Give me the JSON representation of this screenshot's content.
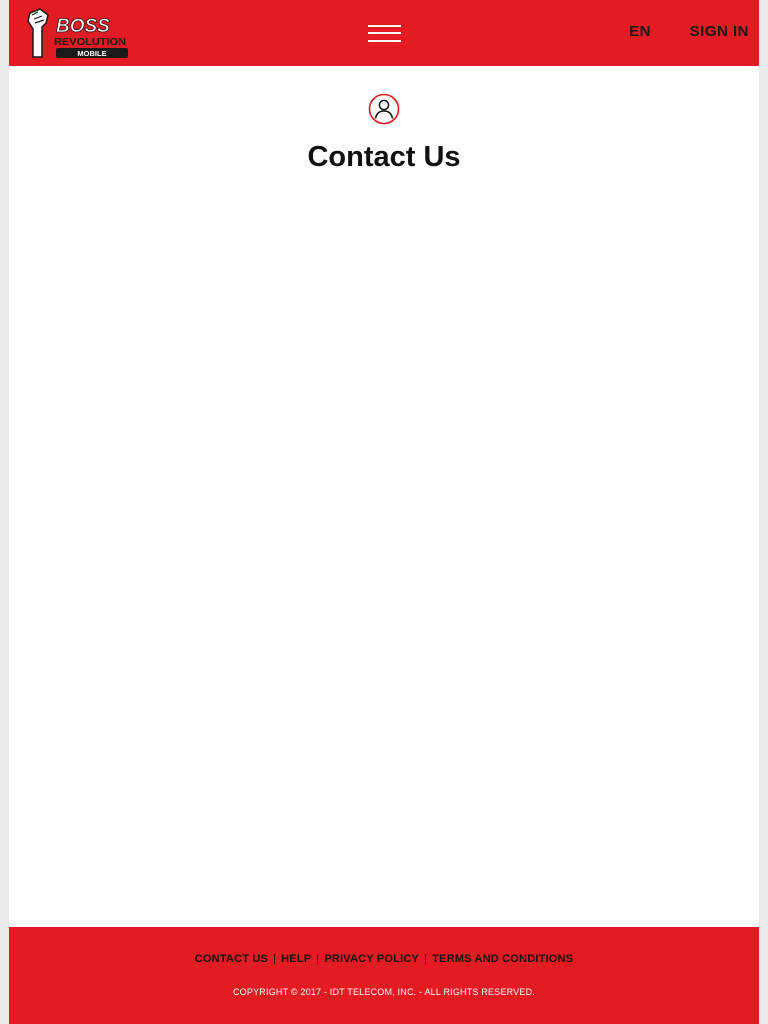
{
  "header": {
    "logo": {
      "line1": "BOSS",
      "line2": "REVOLUTION",
      "line3": "MOBILE"
    },
    "menu_icon": "hamburger-menu-icon",
    "language_label": "EN",
    "signin_label": "SIGN IN"
  },
  "main": {
    "icon": "person-circle-icon",
    "title": "Contact Us"
  },
  "footer": {
    "links": [
      {
        "label": "CONTACT US"
      },
      {
        "label": "HELP"
      },
      {
        "label": "PRIVACY POLICY"
      },
      {
        "label": "TERMS AND CONDITIONS"
      }
    ],
    "separator": "|",
    "copyright": "COPYRIGHT © 2017 - IDT TELECOM, INC. - ALL RIGHTS RESERVED."
  },
  "colors": {
    "brand_red": "#e31b23",
    "text_dark": "#111111",
    "background": "#ffffff",
    "outer_background": "#ebebeb"
  }
}
